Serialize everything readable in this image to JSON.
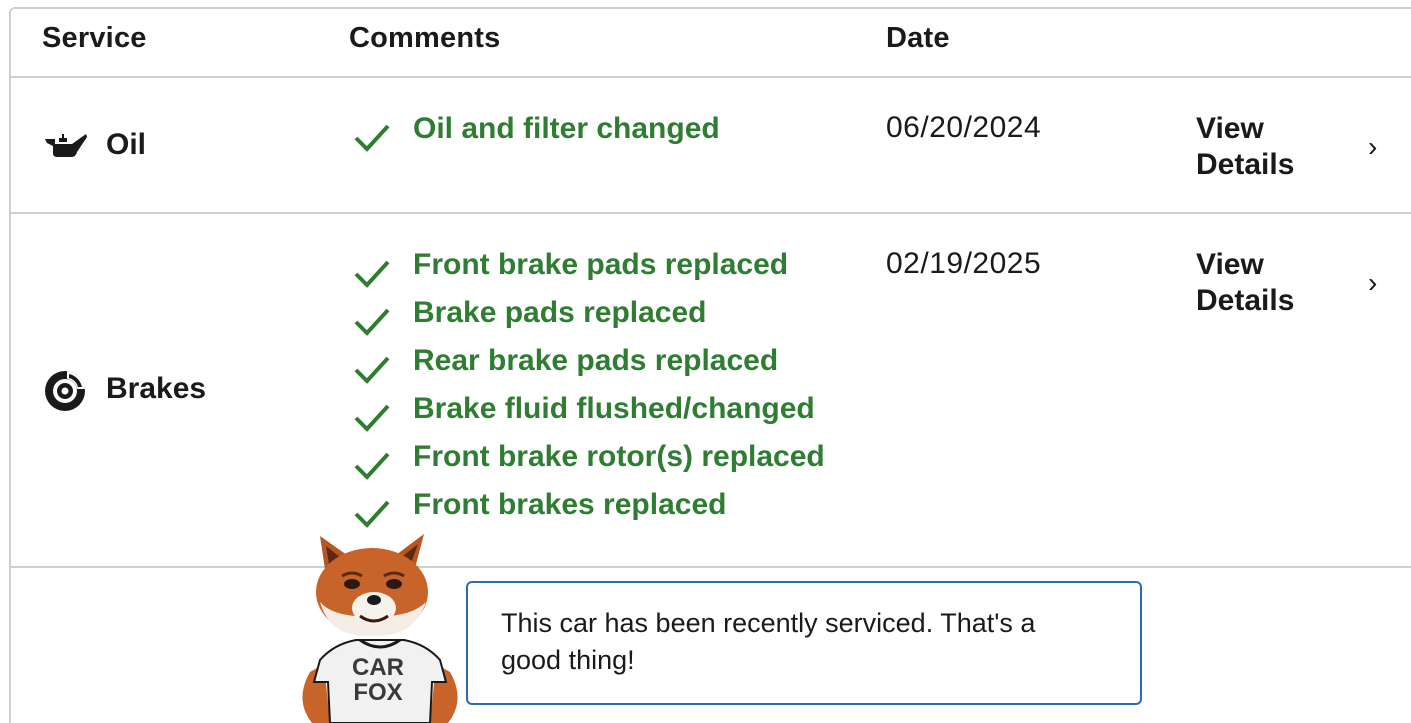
{
  "table": {
    "headers": {
      "service": "Service",
      "comments": "Comments",
      "date": "Date"
    },
    "rows": [
      {
        "service": "Oil",
        "icon": "oil-can-icon",
        "comments": [
          "Oil and filter changed"
        ],
        "date": "06/20/2024",
        "details_label": "View Details",
        "chevron": "›"
      },
      {
        "service": "Brakes",
        "icon": "brake-disc-icon",
        "comments": [
          "Front brake pads replaced",
          "Brake pads replaced",
          "Rear brake pads replaced",
          "Brake fluid flushed/changed",
          "Front brake rotor(s) replaced",
          "Front brakes replaced"
        ],
        "date": "02/19/2025",
        "details_label": "View Details",
        "chevron": "›"
      }
    ]
  },
  "mascot": {
    "shirt_text": "CAR FOX",
    "message": "This car has been recently serviced. That's a good thing!"
  },
  "colors": {
    "comment_green": "#2e7d32",
    "bubble_border": "#2a6ab5",
    "divider": "#cfcfcf",
    "text": "#1a1a1a"
  }
}
